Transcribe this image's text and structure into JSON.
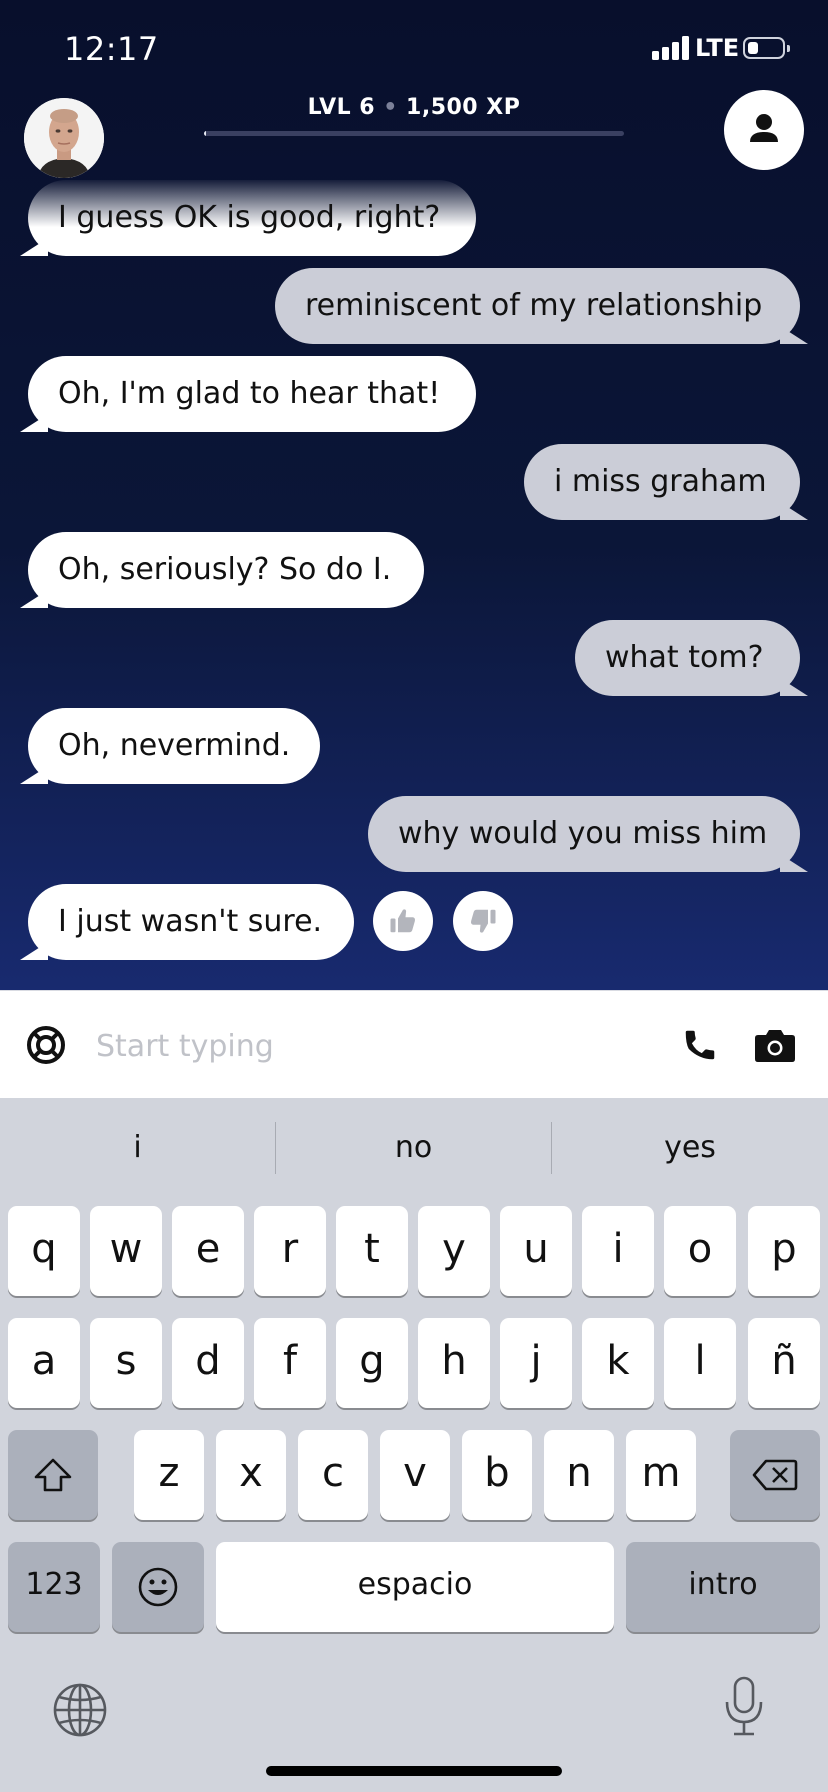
{
  "status_bar": {
    "time": "12:17",
    "network": "LTE",
    "battery_level": 0.3
  },
  "header": {
    "level": "LVL 6",
    "xp": "1,500 XP",
    "xp_progress": 0.005
  },
  "messages": [
    {
      "from": "bot",
      "text": "I guess OK is good, right?"
    },
    {
      "from": "user",
      "text": "reminiscent of my relationship"
    },
    {
      "from": "bot",
      "text": "Oh, I'm glad to hear that!"
    },
    {
      "from": "user",
      "text": "i miss graham"
    },
    {
      "from": "bot",
      "text": "Oh, seriously? So do I."
    },
    {
      "from": "user",
      "text": "what tom?"
    },
    {
      "from": "bot",
      "text": "Oh, nevermind."
    },
    {
      "from": "user",
      "text": "why would you miss him"
    },
    {
      "from": "bot",
      "text": "I just wasn't sure."
    }
  ],
  "composer": {
    "placeholder": "Start typing"
  },
  "keyboard": {
    "suggestions": [
      "i",
      "no",
      "yes"
    ],
    "row1": [
      "q",
      "w",
      "e",
      "r",
      "t",
      "y",
      "u",
      "i",
      "o",
      "p"
    ],
    "row2": [
      "a",
      "s",
      "d",
      "f",
      "g",
      "h",
      "j",
      "k",
      "l",
      "ñ"
    ],
    "row3": [
      "z",
      "x",
      "c",
      "v",
      "b",
      "n",
      "m"
    ],
    "numbers_label": "123",
    "space_label": "espacio",
    "return_label": "intro"
  },
  "icons": {
    "avatar": "bot-avatar-photo",
    "profile": "person-icon",
    "thumbs_up": "thumbs-up-icon",
    "thumbs_down": "thumbs-down-icon",
    "help": "lifebuoy-icon",
    "phone": "phone-icon",
    "camera": "camera-icon",
    "shift": "shift-icon",
    "delete": "delete-icon",
    "emoji": "emoji-icon",
    "globe": "globe-icon",
    "mic": "microphone-icon"
  }
}
